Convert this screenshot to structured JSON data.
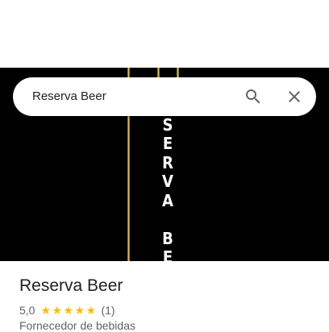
{
  "search": {
    "query": "Reserva Beer"
  },
  "photo": {
    "vertical_text": "E\nS\nE\nR\nV\nA\n\nB\nE"
  },
  "place": {
    "name": "Reserva Beer",
    "rating": "5,0",
    "star_count": 5,
    "review_count": "(1)",
    "category": "Fornecedor de bebidas"
  },
  "colors": {
    "star": "#fbbc04",
    "photo_bg": "#000000",
    "gold": "#e8c96a"
  },
  "icons": {
    "search": "search-icon",
    "close": "close-icon",
    "star": "star-icon"
  }
}
